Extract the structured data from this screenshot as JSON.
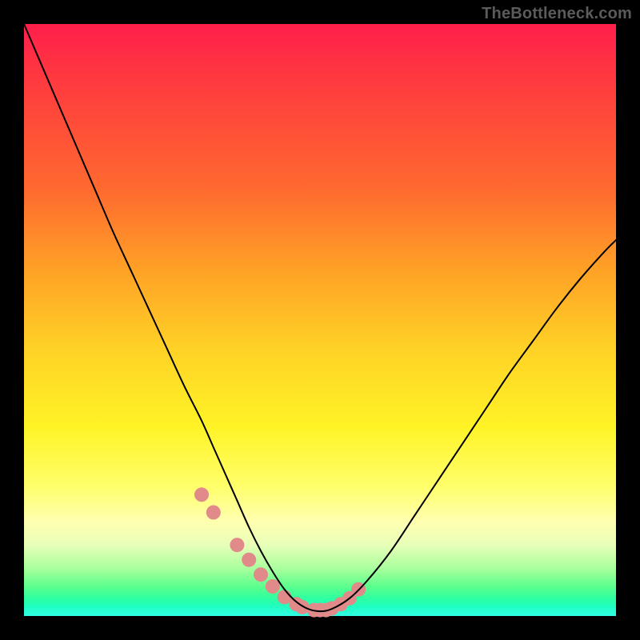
{
  "watermark": "TheBottleneck.com",
  "chart_data": {
    "type": "line",
    "title": "",
    "xlabel": "",
    "ylabel": "",
    "xlim": [
      0,
      100
    ],
    "ylim": [
      0,
      100
    ],
    "grid": false,
    "legend": null,
    "series": [
      {
        "name": "bottleneck-curve",
        "color": "#000000",
        "x": [
          0,
          3,
          6,
          9,
          12,
          15,
          18,
          21,
          24,
          27,
          30,
          32,
          34,
          36,
          38,
          40,
          42,
          44,
          46,
          48,
          50,
          52,
          55,
          58,
          62,
          66,
          70,
          74,
          78,
          82,
          86,
          90,
          94,
          98,
          100
        ],
        "y": [
          100,
          93,
          86,
          79,
          72,
          65,
          58.5,
          52,
          45.5,
          39,
          33,
          28.5,
          24,
          19.5,
          15,
          11,
          7.5,
          4.5,
          2.4,
          1.2,
          0.8,
          1.2,
          3,
          6,
          11,
          17,
          23,
          29,
          35,
          41,
          46.5,
          52,
          57,
          61.5,
          63.5
        ]
      }
    ],
    "highlight_points": {
      "name": "critical-zone-dots",
      "color": "#e08a8a",
      "radius_px": 9,
      "x": [
        30,
        32,
        36,
        38,
        40,
        42,
        44,
        46,
        47,
        49,
        50,
        51,
        52,
        53.5,
        55,
        56.5
      ],
      "y": [
        20.5,
        17.5,
        12,
        9.5,
        7,
        5,
        3.2,
        2,
        1.5,
        1,
        1,
        1,
        1.3,
        2,
        3,
        4.5
      ]
    },
    "background": {
      "type": "vertical-gradient",
      "stops": [
        {
          "pos": 0.0,
          "color": "#ff1f4b"
        },
        {
          "pos": 0.1,
          "color": "#ff3b3f"
        },
        {
          "pos": 0.28,
          "color": "#ff6a2f"
        },
        {
          "pos": 0.42,
          "color": "#ffa326"
        },
        {
          "pos": 0.55,
          "color": "#ffd226"
        },
        {
          "pos": 0.68,
          "color": "#fff326"
        },
        {
          "pos": 0.78,
          "color": "#ffff6a"
        },
        {
          "pos": 0.84,
          "color": "#ffffb0"
        },
        {
          "pos": 0.88,
          "color": "#e8ffb8"
        },
        {
          "pos": 0.92,
          "color": "#a8ff9d"
        },
        {
          "pos": 0.95,
          "color": "#5cff8c"
        },
        {
          "pos": 0.97,
          "color": "#2effa0"
        },
        {
          "pos": 0.985,
          "color": "#1fffc4"
        },
        {
          "pos": 1.0,
          "color": "#33ffe6"
        }
      ]
    }
  }
}
